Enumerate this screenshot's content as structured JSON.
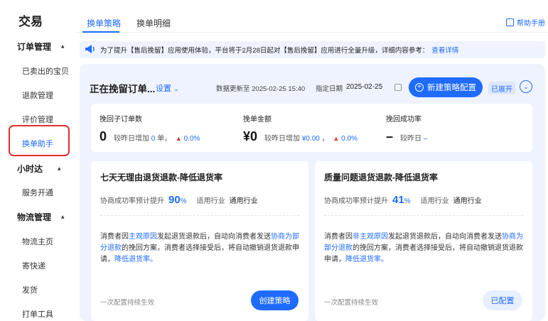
{
  "sidebar": {
    "title": "交易",
    "groups": [
      {
        "label": "订单管理",
        "items": [
          "已卖出的宝贝",
          "退款管理",
          "评价管理",
          "换单助手"
        ]
      },
      {
        "label": "小时达",
        "items": [
          "服务开通"
        ]
      },
      {
        "label": "物流管理",
        "items": [
          "物流主页",
          "寄快递",
          "发货",
          "打单工具"
        ]
      }
    ],
    "active_item": "换单助手"
  },
  "tabs": [
    {
      "label": "换单策略",
      "active": true
    },
    {
      "label": "换单明细",
      "active": false
    }
  ],
  "help": {
    "label": "帮助手册"
  },
  "notice": {
    "text": "为了提升【售后挽留】应用使用体验，平台将于2月28日起对【售后挽留】应用进行全量升级，详细内容参考：",
    "link": "查看详情"
  },
  "panel": {
    "title": "正在挽留订单...",
    "settings_label": "设置",
    "updated_text": "数据更新至 2025-02-25 15:40",
    "date_label": "指定日期",
    "date_value": "2025-02-25",
    "new_button": "新建策略配置",
    "expanded_badge": "已展开"
  },
  "stats": [
    {
      "label": "挽回子订单数",
      "value": "0",
      "sub_prefix": "较昨日增加",
      "sub_value": "0",
      "sub_unit": "单，",
      "change": "0.0%"
    },
    {
      "label": "挽单金额",
      "value": "¥0",
      "sub_prefix": "较昨日增加",
      "sub_value": "¥0.00",
      "sub_unit": "，",
      "change": "0.0%"
    },
    {
      "label": "挽回成功率",
      "value": "–",
      "sub_prefix": "较昨日",
      "sub_value": "–",
      "sub_unit": "",
      "change": ""
    }
  ],
  "cards": [
    {
      "title": "七天无理由退货退款-降低退货率",
      "rate_label": "协商成功率预计提升",
      "rate_value": "90",
      "rate_unit": "%",
      "industry_label": "适用行业",
      "industry_value": "通用行业",
      "desc_1": "消费者因",
      "desc_2": "主观原因",
      "desc_3": "发起退货退款后，自动向消费者发送",
      "desc_4": "协商为部分退款",
      "desc_5": "的挽回方案，消费者选择接受后，将自动撤销退货退款申请，",
      "desc_6": "降低退货率。",
      "footer": "一次配置持续生效",
      "button": "创建策略"
    },
    {
      "title": "质量问题退货退款-降低退货率",
      "rate_label": "协商成功率预计提升",
      "rate_value": "41",
      "rate_unit": "%",
      "industry_label": "适用行业",
      "industry_value": "通用行业",
      "desc_1": "消费者因",
      "desc_2": "非主观原因",
      "desc_3": "发起退货退款后，自动向消费者发送",
      "desc_4": "协商为部分退款",
      "desc_5": "的挽回方案，消费者选择接受后，将自动撤销退货退款申请，",
      "desc_6": "降低退货率。",
      "footer": "一次配置持续生效",
      "button": "已配置"
    }
  ],
  "colors": {
    "accent": "#1f6bff",
    "highlight_box": "#e0302c",
    "panel_bg": "#eef3ff"
  }
}
